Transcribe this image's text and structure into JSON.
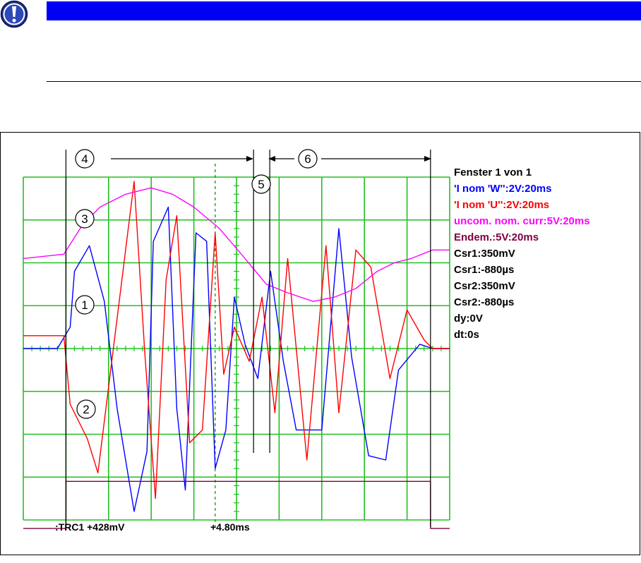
{
  "notice": {
    "icon": "exclamation-icon",
    "bar_color": "#0000f5"
  },
  "chart_data": {
    "type": "line",
    "title": "",
    "grid": true,
    "grid_color": "#22c022",
    "x_divisions": 10,
    "y_divisions": 8,
    "x_unit": "ms per division",
    "legend_placement": "right",
    "legend": [
      {
        "text": "Fenster 1 von 1",
        "color": "#000000"
      },
      {
        "text": "'I nom 'W'':2V:20ms",
        "color": "#0000ff"
      },
      {
        "text": "'I nom 'U'':2V:20ms",
        "color": "#ff0000"
      },
      {
        "text": "uncom. nom. curr:5V:20ms",
        "color": "#ff00ff"
      },
      {
        "text": "Endem.:5V:20ms",
        "color": "#800040"
      },
      {
        "text": "Csr1:350mV",
        "color": "#000000"
      },
      {
        "text": "Csr1:-880µs",
        "color": "#000000"
      },
      {
        "text": "Csr2:350mV",
        "color": "#000000"
      },
      {
        "text": "Csr2:-880µs",
        "color": "#000000"
      },
      {
        "text": "dy:0V",
        "color": "#000000"
      },
      {
        "text": "dt:0s",
        "color": "#000000"
      }
    ],
    "readouts": {
      "trigger": ":TRC1 +428mV",
      "time": "+4.80ms"
    },
    "markers": [
      "1",
      "2",
      "3",
      "4",
      "5",
      "6"
    ],
    "series": [
      {
        "name": "'I nom 'W''",
        "color": "#0000ff",
        "x": [
          0,
          0.8,
          1.1,
          1.2,
          1.55,
          1.9,
          2.2,
          2.6,
          2.9,
          3.05,
          3.4,
          3.6,
          3.8,
          4.05,
          4.3,
          4.5,
          4.75,
          4.95,
          5.2,
          5.5,
          5.8,
          6.1,
          6.4,
          7.0,
          7.4,
          7.7,
          8.1,
          8.5,
          8.8,
          9.3,
          9.6,
          10
        ],
        "y": [
          0,
          0,
          0.5,
          1.8,
          2.4,
          1.1,
          -1.4,
          -3.8,
          -2.4,
          2.5,
          3.3,
          -1.4,
          -3.3,
          2.7,
          2.5,
          -2.8,
          -1.9,
          1.2,
          0.1,
          -0.7,
          1.8,
          -0.3,
          -1.9,
          -1.9,
          2.8,
          -0.2,
          -2.5,
          -2.6,
          -0.5,
          0.1,
          0,
          0
        ]
      },
      {
        "name": "'I nom 'U''",
        "color": "#ff0000",
        "x": [
          0,
          0.95,
          1.1,
          1.5,
          1.75,
          2.3,
          2.6,
          2.85,
          3.1,
          3.35,
          3.6,
          3.9,
          4.2,
          4.5,
          4.7,
          4.95,
          5.3,
          5.6,
          5.9,
          6.2,
          6.65,
          7.1,
          7.4,
          7.8,
          8.15,
          8.6,
          9.0,
          9.4,
          9.6,
          10
        ],
        "y": [
          0.3,
          0.3,
          -1.3,
          -2.1,
          -2.9,
          1.5,
          3.9,
          -0.1,
          -3.5,
          1.6,
          3.1,
          -2.2,
          -1.9,
          2.7,
          -0.6,
          0.5,
          -0.3,
          1.2,
          -1.5,
          2.1,
          -2.6,
          2.4,
          -1.5,
          2.3,
          1.9,
          -0.7,
          0.9,
          0.2,
          0,
          0
        ]
      },
      {
        "name": "uncom. nom. curr",
        "color": "#ff00ff",
        "x": [
          0,
          0.95,
          1.4,
          1.8,
          2.4,
          3.0,
          3.5,
          4.0,
          4.6,
          5.2,
          5.7,
          6.2,
          6.8,
          7.3,
          7.8,
          8.3,
          8.7,
          9.1,
          9.6,
          10
        ],
        "y": [
          2.1,
          2.2,
          2.9,
          3.3,
          3.6,
          3.75,
          3.6,
          3.3,
          2.8,
          2.1,
          1.5,
          1.3,
          1.1,
          1.2,
          1.4,
          1.8,
          2.0,
          2.1,
          2.3,
          2.3
        ]
      },
      {
        "name": "Endem.",
        "color": "#800040",
        "x": [
          0,
          1.0,
          1.001,
          9.55,
          9.551,
          9.85,
          10
        ],
        "y": [
          -4.2,
          -4.2,
          -3.1,
          -3.1,
          -4.2,
          -4.2,
          -4.2
        ]
      }
    ],
    "cursors_x": [
      1.0,
      5.4,
      5.78,
      9.55
    ]
  }
}
